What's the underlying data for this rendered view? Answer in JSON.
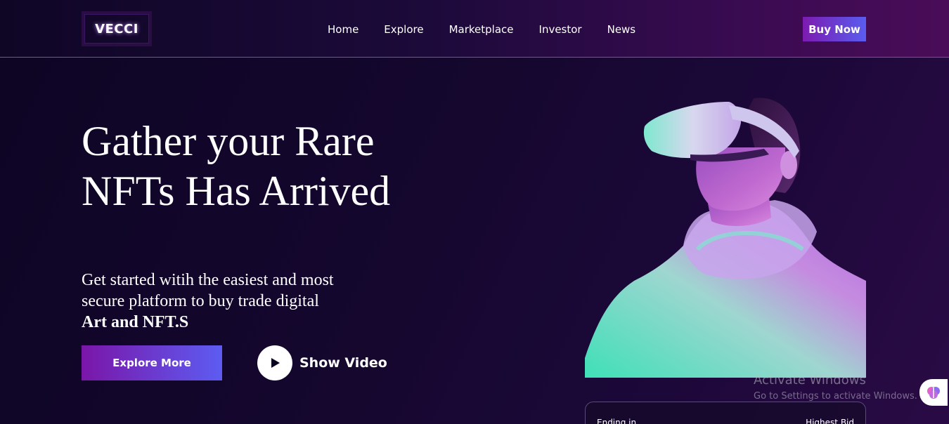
{
  "header": {
    "logo": "VECCI",
    "nav": [
      "Home",
      "Explore",
      "Marketplace",
      "Investor",
      "News"
    ],
    "buy_label": "Buy Now"
  },
  "hero": {
    "title": "Gather your Rare NFTs Has Arrived",
    "subtitle_lead": "Get started witih the easiest and most secure platform to buy trade digital",
    "subtitle_bold": "Art and NFT.S",
    "explore_label": "Explore More",
    "video_label": "Show Video"
  },
  "card": {
    "left_label": "Ending in",
    "right_label": "Highest Bid"
  },
  "watermark": {
    "title": "Activate Windows",
    "subtitle": "Go to Settings to activate Windows."
  },
  "icons": {
    "play": "play-icon",
    "corner": "brain-icon"
  },
  "colors": {
    "accent_start": "#7a16a8",
    "accent_end": "#5d5cf2",
    "background": "#15072e"
  }
}
